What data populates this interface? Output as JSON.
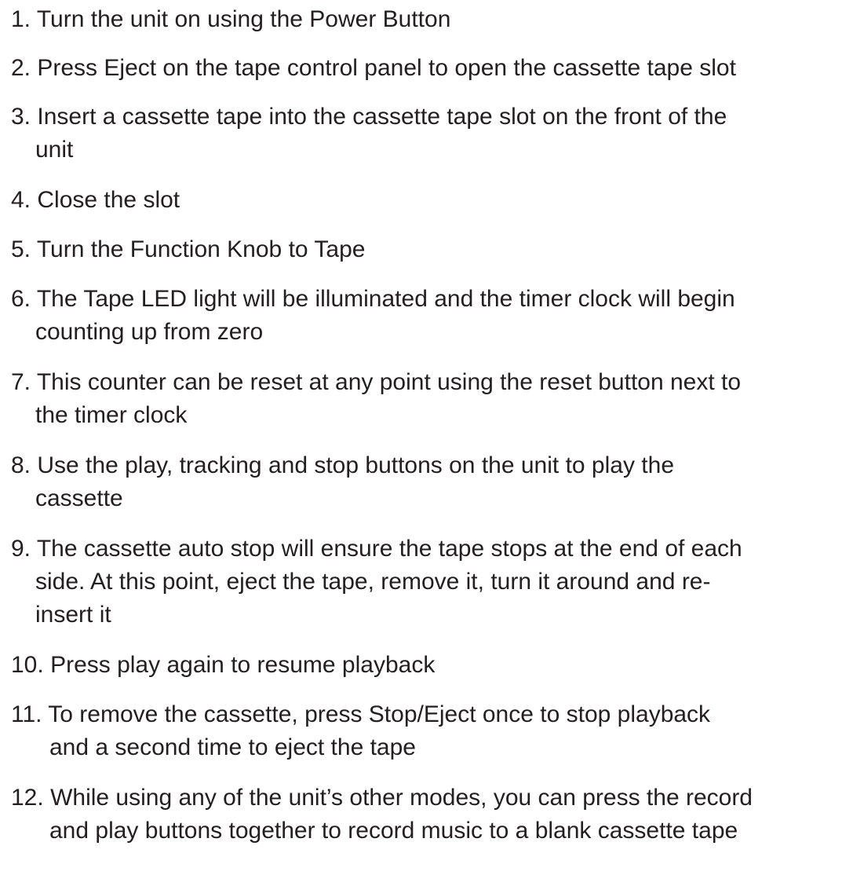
{
  "steps": [
    {
      "num": "1.",
      "lines": [
        "Turn the unit on using the Power Button"
      ]
    },
    {
      "num": "2.",
      "lines": [
        "Press Eject on the tape control panel to open the cassette tape slot"
      ]
    },
    {
      "num": "3.",
      "lines": [
        "Insert a cassette tape into the cassette tape slot on the front of the",
        "unit"
      ]
    },
    {
      "num": "4.",
      "lines": [
        "Close the slot"
      ]
    },
    {
      "num": "5.",
      "lines": [
        "Turn the Function Knob to Tape"
      ]
    },
    {
      "num": "6.",
      "lines": [
        "The Tape LED light will be illuminated and the timer clock will begin",
        "counting up from zero"
      ]
    },
    {
      "num": "7.",
      "lines": [
        "This counter can be reset at any point using the reset button next to",
        "the timer clock"
      ]
    },
    {
      "num": "8.",
      "lines": [
        "Use the play, tracking and stop buttons on the unit to play the",
        "cassette"
      ]
    },
    {
      "num": "9.",
      "lines": [
        "The cassette auto stop will ensure the tape stops at the end of each",
        "side. At this point, eject the tape, remove it, turn it around and re-",
        "insert it"
      ]
    },
    {
      "num": "10.",
      "lines": [
        "Press play again to resume playback"
      ]
    },
    {
      "num": "11.",
      "lines": [
        "To remove the cassette, press Stop/Eject once to stop playback",
        "and a second time to eject the tape"
      ]
    },
    {
      "num": "12.",
      "lines": [
        "While using any of the unit’s other modes, you can press the record",
        "and play buttons together to record music to a blank cassette tape"
      ]
    }
  ]
}
